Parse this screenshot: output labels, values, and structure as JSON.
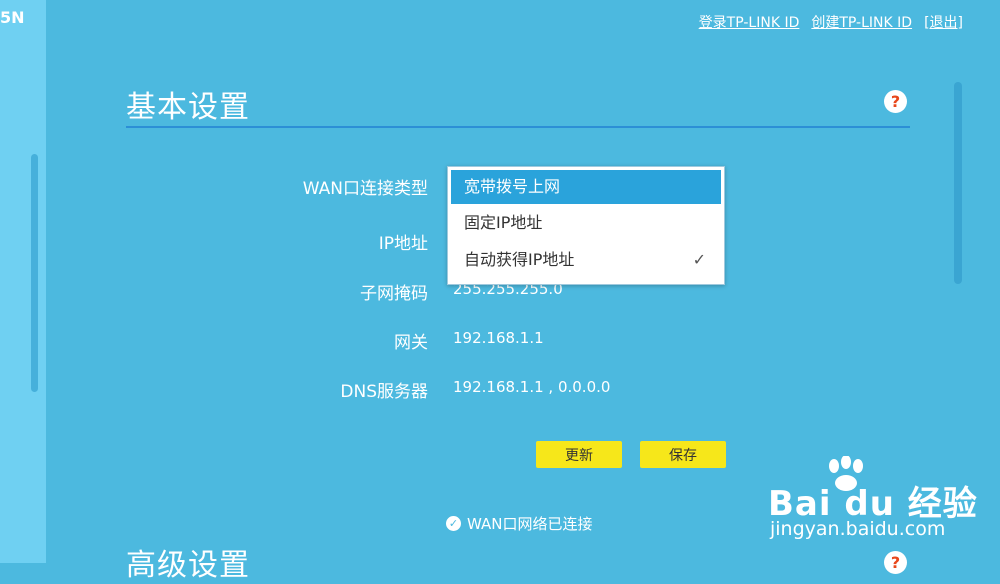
{
  "brand_fragment": "5N",
  "top_links": [
    "登录TP-LINK ID",
    "创建TP-LINK ID",
    "[退出]"
  ],
  "basic": {
    "title": "基本设置",
    "help": "?",
    "rows": [
      {
        "label": "WAN口连接类型",
        "value": ""
      },
      {
        "label": "IP地址",
        "value": ""
      },
      {
        "label": "子网掩码",
        "value": "255.255.255.0"
      },
      {
        "label": "网关",
        "value": "192.168.1.1"
      },
      {
        "label": "DNS服务器",
        "value": "192.168.1.1 , 0.0.0.0"
      }
    ],
    "dropdown": {
      "options": [
        "宽带拨号上网",
        "固定IP地址",
        "自动获得IP地址"
      ],
      "highlighted_index": 0,
      "selected_index": 2
    },
    "buttons": {
      "refresh": "更新",
      "save": "保存"
    },
    "status": "WAN口网络已连接"
  },
  "advanced": {
    "title": "高级设置",
    "help": "?"
  },
  "watermark": {
    "logo_text": "Bai du 经验",
    "url": "jingyan.baidu.com"
  },
  "colors": {
    "background": "#4cb9df",
    "accent": "#2aa3db",
    "button": "#f6e71a",
    "help": "#e8471b"
  }
}
